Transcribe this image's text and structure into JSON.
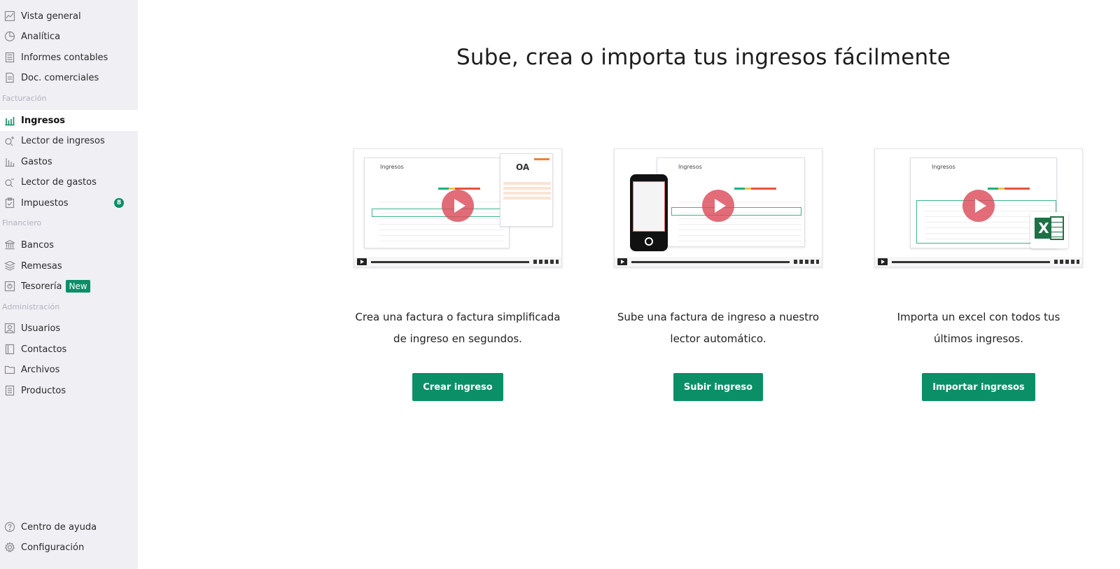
{
  "sidebar": {
    "items_top": [
      {
        "label": "Vista general",
        "icon": "chart-area-icon"
      },
      {
        "label": "Analítica",
        "icon": "pie-chart-icon"
      },
      {
        "label": "Informes contables",
        "icon": "calculator-icon"
      },
      {
        "label": "Doc. comerciales",
        "icon": "document-icon"
      }
    ],
    "section_facturacion": "Facturación",
    "facturacion_items": [
      {
        "label": "Ingresos",
        "icon": "bar-chart-icon",
        "active": true
      },
      {
        "label": "Lector de ingresos",
        "icon": "search-plus-icon"
      },
      {
        "label": "Gastos",
        "icon": "bar-chart-icon"
      },
      {
        "label": "Lector de gastos",
        "icon": "search-minus-icon"
      },
      {
        "label": "Impuestos",
        "icon": "clipboard-check-icon",
        "badge": "8"
      }
    ],
    "section_financiero": "Financiero",
    "financiero_items": [
      {
        "label": "Bancos",
        "icon": "bank-icon"
      },
      {
        "label": "Remesas",
        "icon": "layers-icon"
      },
      {
        "label": "Tesorería",
        "icon": "safe-icon",
        "badge": "New"
      }
    ],
    "section_administracion": "Administración",
    "administracion_items": [
      {
        "label": "Usuarios",
        "icon": "user-card-icon"
      },
      {
        "label": "Contactos",
        "icon": "address-book-icon"
      },
      {
        "label": "Archivos",
        "icon": "folder-icon"
      },
      {
        "label": "Productos",
        "icon": "list-icon"
      }
    ],
    "bottom_items": [
      {
        "label": "Centro de ayuda",
        "icon": "help-circle-icon"
      },
      {
        "label": "Configuración",
        "icon": "gear-icon"
      }
    ]
  },
  "main": {
    "title": "Sube, crea o importa tus ingresos fácilmente",
    "cards": [
      {
        "video_label": "Ingresos",
        "desc_line1": "Crea una factura o factura simplificada",
        "desc_line2": "de ingreso en segundos.",
        "button": "Crear ingreso"
      },
      {
        "video_label": "Ingresos",
        "desc_line1": "Sube una factura de ingreso a nuestro",
        "desc_line2": "lector automático.",
        "button": "Subir ingreso"
      },
      {
        "video_label": "Ingresos",
        "desc_line1": "Importa un excel con todos tus",
        "desc_line2": "últimos ingresos.",
        "button": "Importar ingresos"
      }
    ]
  },
  "colors": {
    "accent": "#0a8f67",
    "sidebar_bg": "#f0eff4",
    "play_button": "#dc4c5a"
  }
}
